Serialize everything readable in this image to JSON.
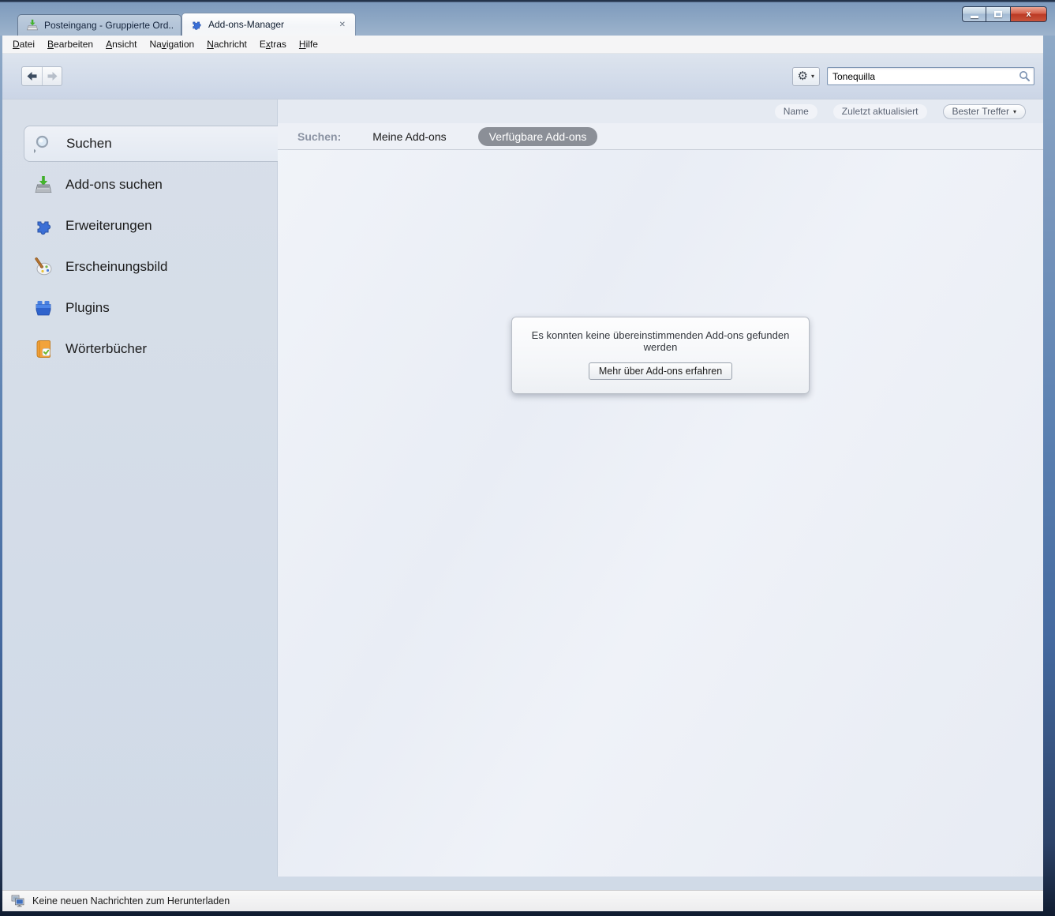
{
  "window": {
    "controls": {
      "minimize": "minimize",
      "maximize": "maximize",
      "close_glyph": "x"
    }
  },
  "tabs": [
    {
      "title": "Posteingang - Gruppierte Ord...",
      "icon": "inbox-icon",
      "active": false
    },
    {
      "title": "Add-ons-Manager",
      "icon": "puzzle-icon",
      "active": true,
      "close_glyph": "✕"
    }
  ],
  "menu": {
    "items": [
      {
        "pre": "",
        "key": "D",
        "post": "atei"
      },
      {
        "pre": "",
        "key": "B",
        "post": "earbeiten"
      },
      {
        "pre": "",
        "key": "A",
        "post": "nsicht"
      },
      {
        "pre": "Na",
        "key": "v",
        "post": "igation"
      },
      {
        "pre": "",
        "key": "N",
        "post": "achricht"
      },
      {
        "pre": "E",
        "key": "x",
        "post": "tras"
      },
      {
        "pre": "",
        "key": "H",
        "post": "ilfe"
      }
    ]
  },
  "toolbar": {
    "back_icon": "arrow-left",
    "forward_icon": "arrow-right",
    "forward_enabled": false,
    "gear_glyph": "⚙",
    "caret_glyph": "▾",
    "search": {
      "value": "Tonequilla",
      "icon": "magnifier-icon"
    }
  },
  "sort": {
    "buttons": [
      {
        "label": "Name",
        "active": false
      },
      {
        "label": "Zuletzt aktualisiert",
        "active": false
      },
      {
        "label": "Bester Treffer",
        "active": true,
        "caret_glyph": "▾"
      }
    ]
  },
  "filter": {
    "label": "Suchen:",
    "options": [
      {
        "label": "Meine Add-ons",
        "selected": false
      },
      {
        "label": "Verfügbare Add-ons",
        "selected": true
      }
    ]
  },
  "sidebar": {
    "items": [
      {
        "label": "Suchen",
        "icon": "search-icon",
        "selected": true
      },
      {
        "label": "Add-ons suchen",
        "icon": "download-tray-icon",
        "selected": false
      },
      {
        "label": "Erweiterungen",
        "icon": "puzzle-icon",
        "selected": false
      },
      {
        "label": "Erscheinungsbild",
        "icon": "palette-icon",
        "selected": false
      },
      {
        "label": "Plugins",
        "icon": "brick-icon",
        "selected": false
      },
      {
        "label": "Wörterbücher",
        "icon": "dictionary-book-icon",
        "selected": false
      }
    ]
  },
  "empty_state": {
    "message": "Es konnten keine übereinstimmenden Add-ons gefunden werden",
    "button_label": "Mehr über Add-ons erfahren"
  },
  "statusbar": {
    "icon": "network-monitors-icon",
    "text": "Keine neuen Nachrichten zum Herunterladen"
  },
  "colors": {
    "titlebar_glass": "#8da7c4",
    "close_button_red": "#bb3a24",
    "accent_blue": "#3b6fd6",
    "sidebar_bg": "#d5dde9",
    "content_bg": "#eef1f7",
    "selected_pill_gray": "#8b8f97",
    "frame_bottom_navy": "#101c30"
  }
}
